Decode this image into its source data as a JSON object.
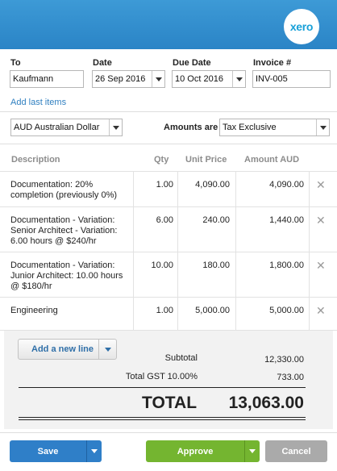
{
  "header": {
    "logo_text": "xero",
    "brand_color": "#2a84c6"
  },
  "fields": {
    "to": {
      "label": "To",
      "value": "Kaufmann"
    },
    "date": {
      "label": "Date",
      "value": "26 Sep 2016"
    },
    "due_date": {
      "label": "Due Date",
      "value": "10 Oct 2016"
    },
    "invoice": {
      "label": "Invoice #",
      "value": "INV-005"
    }
  },
  "add_last_items": "Add last items",
  "currency": "AUD Australian Dollar",
  "amounts_are": {
    "label": "Amounts are",
    "value": "Tax Exclusive"
  },
  "columns": {
    "description": "Description",
    "qty": "Qty",
    "unit_price": "Unit Price",
    "amount": "Amount AUD"
  },
  "rows": [
    {
      "description": [
        "Documentation: 20%",
        "completion (previously 0%)"
      ],
      "qty": "1.00",
      "unit_price": "4,090.00",
      "amount": "4,090.00"
    },
    {
      "description": [
        "Documentation - Variation:",
        "Senior Architect - Variation:",
        "6.00 hours @ $240/hr"
      ],
      "qty": "6.00",
      "unit_price": "240.00",
      "amount": "1,440.00"
    },
    {
      "description": [
        "Documentation - Variation:",
        "Junior Architect: 10.00 hours",
        "@ $180/hr"
      ],
      "qty": "10.00",
      "unit_price": "180.00",
      "amount": "1,800.00"
    },
    {
      "description": [
        "Engineering"
      ],
      "qty": "1.00",
      "unit_price": "5,000.00",
      "amount": "5,000.00"
    }
  ],
  "add_new_line": "Add a new line",
  "totals": {
    "subtotal_label": "Subtotal",
    "subtotal": "12,330.00",
    "gst_label": "Total GST 10.00%",
    "gst": "733.00",
    "total_label": "TOTAL",
    "total": "13,063.00"
  },
  "buttons": {
    "save": "Save",
    "approve": "Approve",
    "cancel": "Cancel"
  },
  "colors": {
    "save": "#2f7fc8",
    "approve": "#74b530",
    "cancel": "#aaaaaa"
  },
  "icons": {
    "remove": "close-icon",
    "dropdown": "chevron-down-icon"
  }
}
